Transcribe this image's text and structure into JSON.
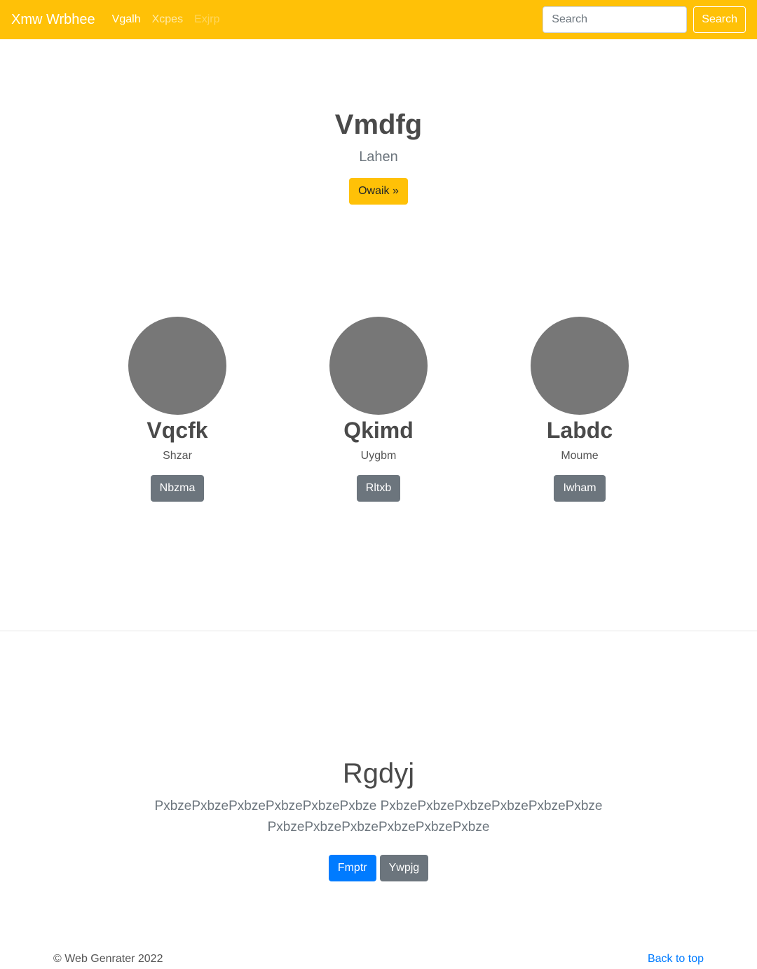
{
  "navbar": {
    "brand": "Xmw Wrbhee",
    "links": [
      {
        "label": "Vgalh",
        "state": "active"
      },
      {
        "label": "Xcpes",
        "state": "normal"
      },
      {
        "label": "Exjrp",
        "state": "disabled"
      }
    ],
    "search_placeholder": "Search",
    "search_button": "Search",
    "color": "#ffc107"
  },
  "hero": {
    "title": "Vmdfg",
    "subtitle": "Lahen",
    "button": "Owaik »"
  },
  "profiles": [
    {
      "name": "Vqcfk",
      "subtitle": "Shzar",
      "button": "Nbzma"
    },
    {
      "name": "Qkimd",
      "subtitle": "Uygbm",
      "button": "Rltxb"
    },
    {
      "name": "Labdc",
      "subtitle": "Moume",
      "button": "Iwham"
    }
  ],
  "feature": {
    "title": "Rgdyj",
    "text": "PxbzePxbzePxbzePxbzePxbzePxbze PxbzePxbzePxbzePxbzePxbzePxbze PxbzePxbzePxbzePxbzePxbzePxbze",
    "primary_button": "Fmptr",
    "secondary_button": "Ywpjg"
  },
  "footer": {
    "copyright": "© Web Genrater 2022",
    "back_to_top": "Back to top"
  }
}
